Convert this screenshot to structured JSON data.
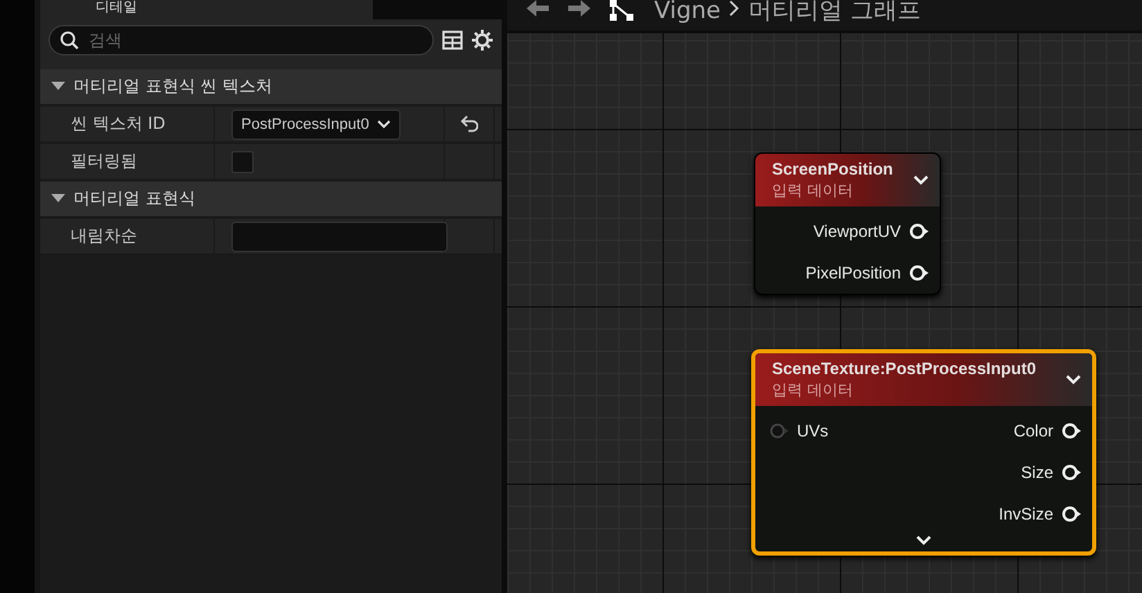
{
  "details_panel": {
    "tab": {
      "label": "디테일"
    },
    "search": {
      "placeholder": "검색"
    },
    "sections": [
      {
        "title": "머티리얼 표현식 씬 텍스처",
        "expanded": true,
        "properties": [
          {
            "kind": "dropdown",
            "label": "씬 텍스처 ID",
            "value": "PostProcessInput0",
            "resettable": true
          },
          {
            "kind": "checkbox",
            "label": "필터링됨",
            "checked": false,
            "resettable": false
          }
        ]
      },
      {
        "title": "머티리얼 표현식",
        "expanded": true,
        "properties": [
          {
            "kind": "text",
            "label": "내림차순",
            "resettable": false
          }
        ]
      }
    ]
  },
  "graph": {
    "breadcrumb": [
      "Vigne",
      "머티리얼 그래프"
    ],
    "nodes": [
      {
        "title": "ScreenPosition",
        "subtitle": "입력 데이터",
        "selected": false,
        "outputs": [
          "ViewportUV",
          "PixelPosition"
        ],
        "advanced": false
      },
      {
        "title": "SceneTexture:PostProcessInput0",
        "subtitle": "입력 데이터",
        "selected": true,
        "inputs": [
          "UVs"
        ],
        "outputs": [
          "Color",
          "Size",
          "InvSize"
        ],
        "advanced": true
      }
    ]
  }
}
